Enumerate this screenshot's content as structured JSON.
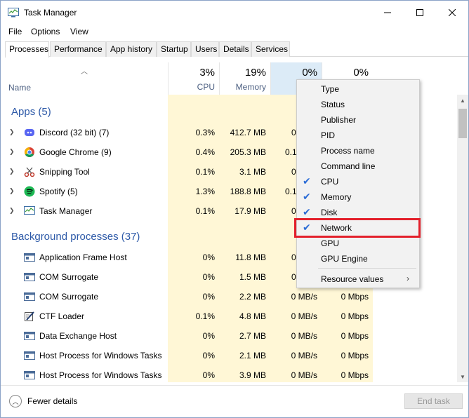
{
  "window": {
    "title": "Task Manager"
  },
  "menu": [
    "File",
    "Options",
    "View"
  ],
  "tabs": [
    "Processes",
    "Performance",
    "App history",
    "Startup",
    "Users",
    "Details",
    "Services"
  ],
  "header": {
    "name_label": "Name",
    "cpu": {
      "pct": "3%",
      "label": "CPU"
    },
    "memory": {
      "pct": "19%",
      "label": "Memory"
    },
    "disk": {
      "pct": "0%"
    },
    "network": {
      "pct": "0%"
    }
  },
  "groups": {
    "apps_title": "Apps (5)",
    "bg_title": "Background processes (37)"
  },
  "apps": [
    {
      "name": "Discord (32 bit) (7)",
      "cpu": "0.3%",
      "memory": "412.7 MB",
      "disk": "0",
      "icon": "discord-icon"
    },
    {
      "name": "Google Chrome (9)",
      "cpu": "0.4%",
      "memory": "205.3 MB",
      "disk": "0.1",
      "icon": "chrome-icon"
    },
    {
      "name": "Snipping Tool",
      "cpu": "0.1%",
      "memory": "3.1 MB",
      "disk": "0",
      "icon": "snipping-tool-icon"
    },
    {
      "name": "Spotify (5)",
      "cpu": "1.3%",
      "memory": "188.8 MB",
      "disk": "0.1",
      "icon": "spotify-icon"
    },
    {
      "name": "Task Manager",
      "cpu": "0.1%",
      "memory": "17.9 MB",
      "disk": "0",
      "icon": "task-manager-icon"
    }
  ],
  "background": [
    {
      "name": "Application Frame Host",
      "cpu": "0%",
      "memory": "11.8 MB",
      "disk": "0",
      "network": "",
      "icon": "app-window-icon"
    },
    {
      "name": "COM Surrogate",
      "cpu": "0%",
      "memory": "1.5 MB",
      "disk": "0",
      "network": "",
      "icon": "app-window-icon"
    },
    {
      "name": "COM Surrogate",
      "cpu": "0%",
      "memory": "2.2 MB",
      "disk": "0 MB/s",
      "network": "0 Mbps",
      "icon": "app-window-icon"
    },
    {
      "name": "CTF Loader",
      "cpu": "0.1%",
      "memory": "4.8 MB",
      "disk": "0 MB/s",
      "network": "0 Mbps",
      "icon": "ctf-loader-icon"
    },
    {
      "name": "Data Exchange Host",
      "cpu": "0%",
      "memory": "2.7 MB",
      "disk": "0 MB/s",
      "network": "0 Mbps",
      "icon": "app-window-icon"
    },
    {
      "name": "Host Process for Windows Tasks",
      "cpu": "0%",
      "memory": "2.1 MB",
      "disk": "0 MB/s",
      "network": "0 Mbps",
      "icon": "app-window-icon"
    },
    {
      "name": "Host Process for Windows Tasks",
      "cpu": "0%",
      "memory": "3.9 MB",
      "disk": "0 MB/s",
      "network": "0 Mbps",
      "icon": "app-window-icon"
    }
  ],
  "context_menu": [
    {
      "label": "Type",
      "checked": false
    },
    {
      "label": "Status",
      "checked": false
    },
    {
      "label": "Publisher",
      "checked": false
    },
    {
      "label": "PID",
      "checked": false
    },
    {
      "label": "Process name",
      "checked": false
    },
    {
      "label": "Command line",
      "checked": false
    },
    {
      "label": "CPU",
      "checked": true
    },
    {
      "label": "Memory",
      "checked": true
    },
    {
      "label": "Disk",
      "checked": true
    },
    {
      "label": "Network",
      "checked": true
    },
    {
      "label": "GPU",
      "checked": false
    },
    {
      "label": "GPU Engine",
      "checked": false
    }
  ],
  "context_submenu": {
    "label": "Resource values"
  },
  "footer": {
    "fewer_details": "Fewer details",
    "end_task": "End task"
  },
  "colors": {
    "accent": "#2e5aa8",
    "highlight_box": "#e3202b",
    "check": "#2b6cd6",
    "usage_light": "#fff4c4",
    "usage_mid": "#ffe8a0"
  }
}
